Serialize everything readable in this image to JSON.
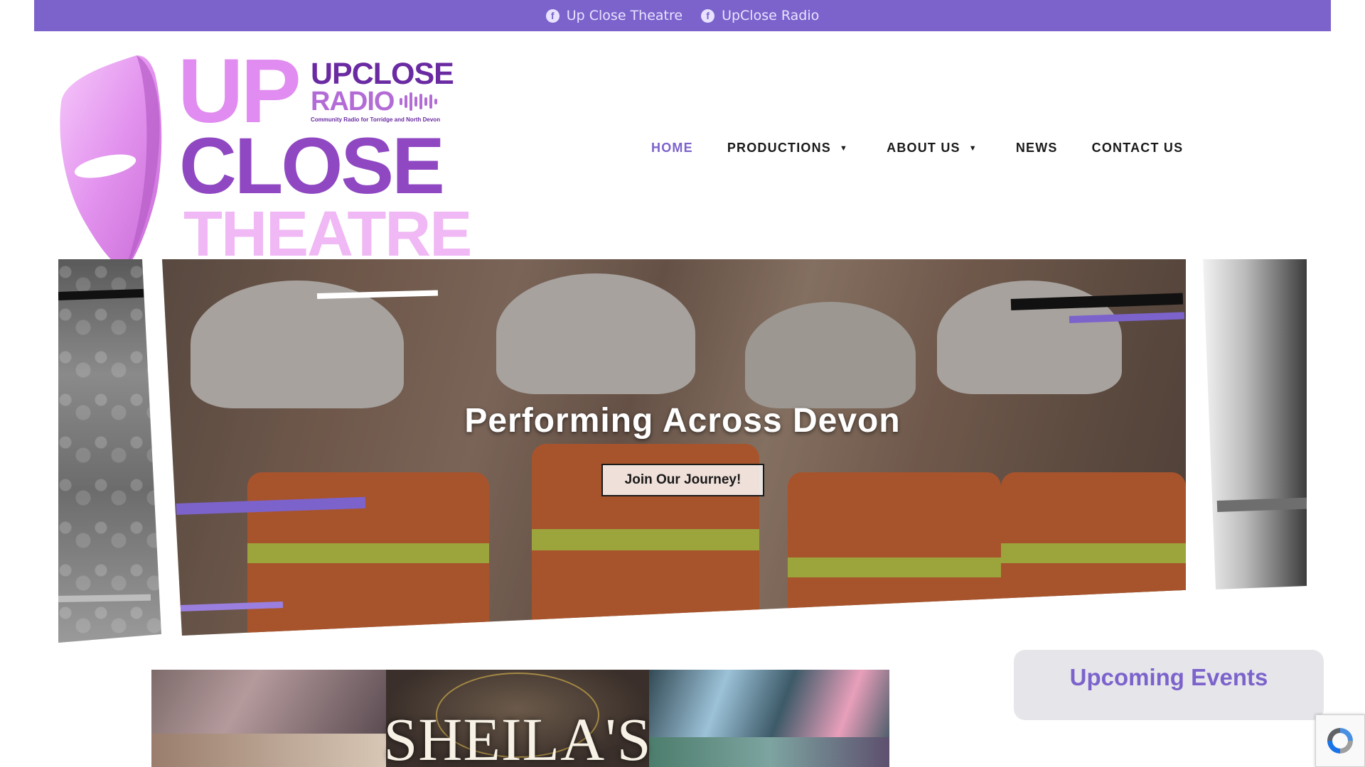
{
  "social": [
    {
      "label": "Up Close Theatre",
      "icon": "facebook-icon"
    },
    {
      "label": "UpClose Radio",
      "icon": "facebook-icon"
    }
  ],
  "logo": {
    "up": "UP",
    "close": "CLOSE",
    "theatre": "THEATRE",
    "radio_line1": "UPCLOSE",
    "radio_line2": "RADIO",
    "radio_tagline": "Community Radio for Torridge and North Devon"
  },
  "nav": {
    "items": [
      {
        "label": "HOME",
        "active": true
      },
      {
        "label": "PRODUCTIONS",
        "dropdown": true
      },
      {
        "label": "ABOUT US",
        "dropdown": true
      },
      {
        "label": "NEWS"
      },
      {
        "label": "CONTACT US"
      }
    ]
  },
  "hero": {
    "title": "Performing Across Devon",
    "button": "Join Our Journey!"
  },
  "poster": {
    "title": "SHEILA'S"
  },
  "events": {
    "title": "Upcoming Events"
  },
  "colors": {
    "accent": "#7c63cc",
    "dark_purple": "#8f48c2",
    "light_pink": "#e08cf0"
  }
}
